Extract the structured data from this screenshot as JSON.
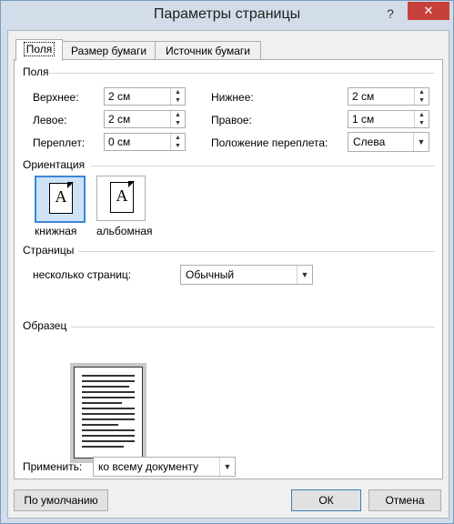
{
  "window": {
    "title": "Параметры страницы",
    "help_glyph": "?",
    "close_glyph": "✕"
  },
  "tabs": [
    {
      "label": "Поля"
    },
    {
      "label": "Размер бумаги"
    },
    {
      "label": "Источник бумаги"
    }
  ],
  "margins": {
    "group_title": "Поля",
    "top": {
      "label": "Верхнее:",
      "value": "2 см"
    },
    "left": {
      "label": "Левое:",
      "value": "2 см"
    },
    "gutter": {
      "label": "Переплет:",
      "value": "0 см"
    },
    "bottom": {
      "label": "Нижнее:",
      "value": "2 см"
    },
    "right": {
      "label": "Правое:",
      "value": "1 см"
    },
    "gutter_position": {
      "label": "Положение переплета:",
      "value": "Слева"
    }
  },
  "orientation": {
    "group_title": "Ориентация",
    "portrait": {
      "label": "книжная",
      "glyph": "A"
    },
    "landscape": {
      "label": "альбомная",
      "glyph": "A"
    },
    "selected": "portrait"
  },
  "pages": {
    "group_title": "Страницы",
    "multiple_label": "несколько страниц:",
    "multiple_value": "Обычный"
  },
  "preview": {
    "group_title": "Образец",
    "apply_label": "Применить:",
    "apply_value": "ко всему документу"
  },
  "buttons": {
    "default": "По умолчанию",
    "ok": "ОК",
    "cancel": "Отмена"
  },
  "colors": {
    "accent": "#3d86d6",
    "close": "#c7413c",
    "frame": "#d2dde9"
  }
}
